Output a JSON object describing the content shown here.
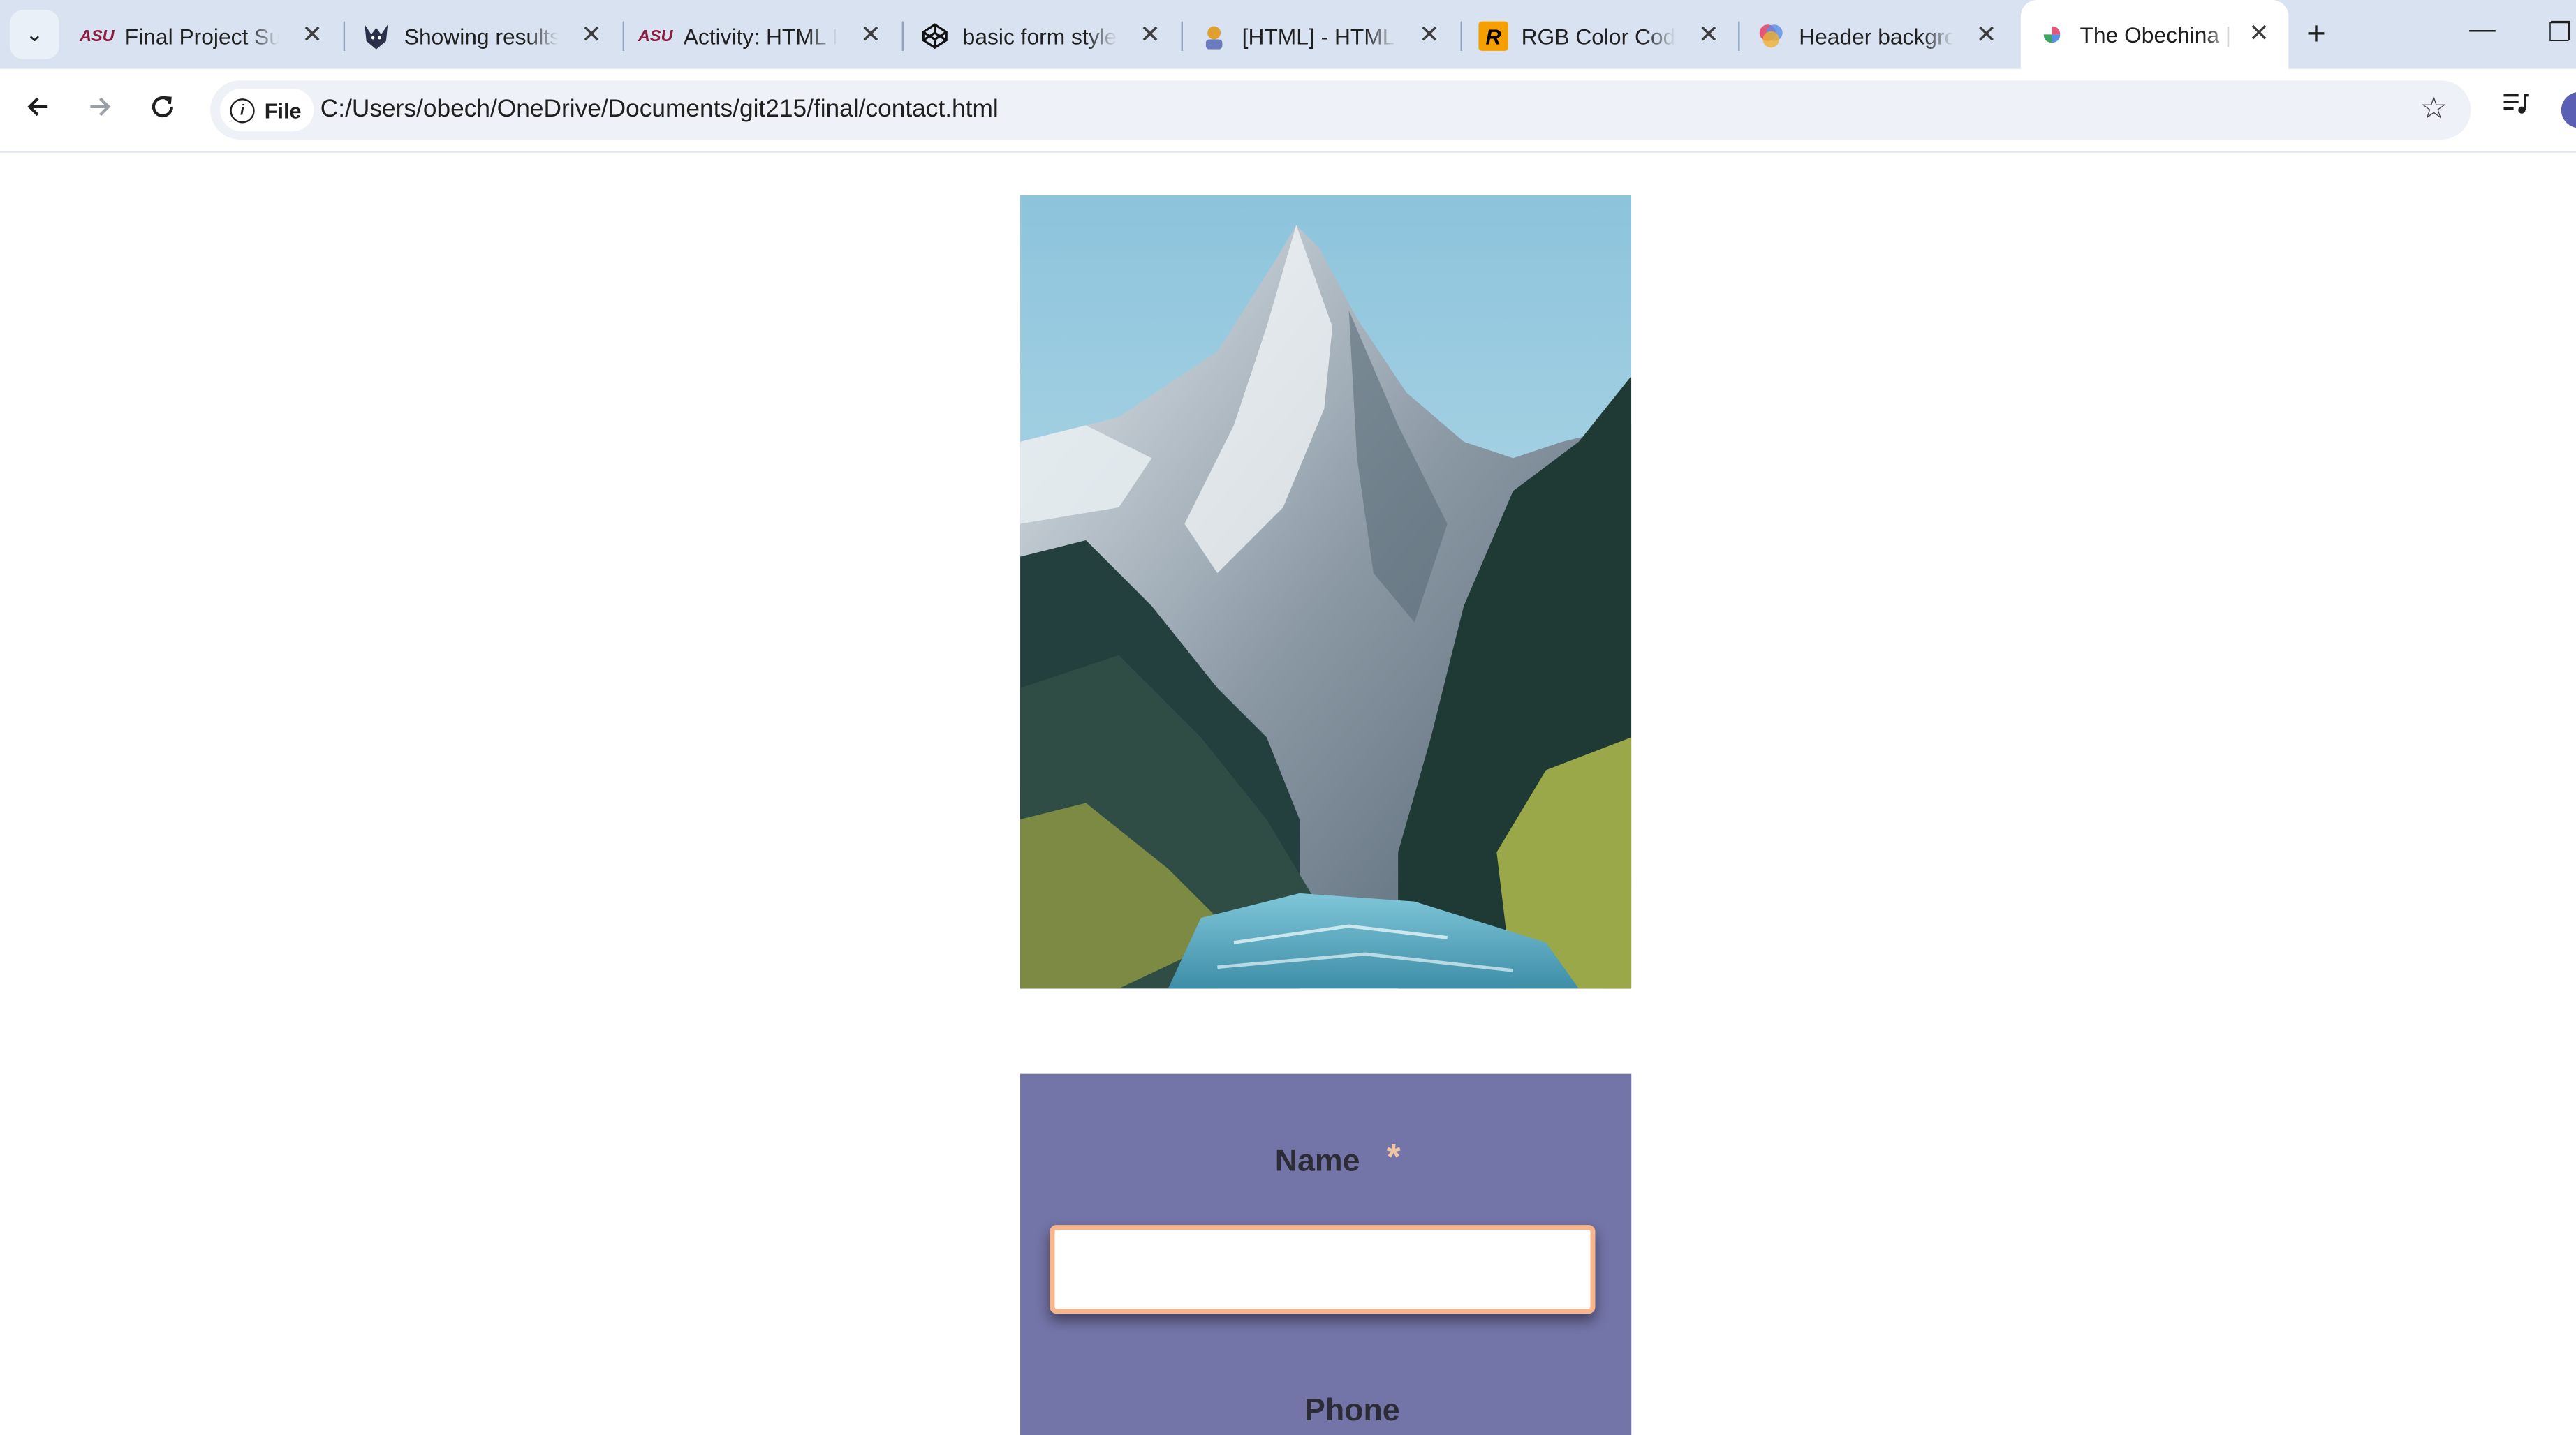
{
  "browser": {
    "tabs": [
      {
        "title": "Final Project Submission",
        "favicon": "asu-logo-icon",
        "active": false
      },
      {
        "title": "Showing results for",
        "favicon": "wolf-logo-icon",
        "active": false
      },
      {
        "title": "Activity: HTML Introduction",
        "favicon": "asu-logo-icon",
        "active": false
      },
      {
        "title": "basic form styles",
        "favicon": "codepen-icon",
        "active": false
      },
      {
        "title": "[HTML] - HTML Forms",
        "favicon": "character-icon",
        "active": false
      },
      {
        "title": "RGB Color Codes",
        "favicon": "r-logo-icon",
        "active": false
      },
      {
        "title": "Header background",
        "favicon": "colorful-logo-icon",
        "active": false
      },
      {
        "title": "The Obechina | Contact",
        "favicon": "globe-icon",
        "active": true
      }
    ],
    "favicon_text": {
      "asu": "ASU",
      "r": "R"
    },
    "address_chip": "File",
    "url": "C:/Users/obech/OneDrive/Documents/git215/final/contact.html"
  },
  "page": {
    "form": {
      "name_label": "Name",
      "required_mark": "*",
      "name_value": "",
      "phone_label": "Phone"
    }
  },
  "colors": {
    "form_bg": "#7374a8",
    "input_border": "#f8b48a",
    "tabbar_bg": "#d8e2f0"
  }
}
